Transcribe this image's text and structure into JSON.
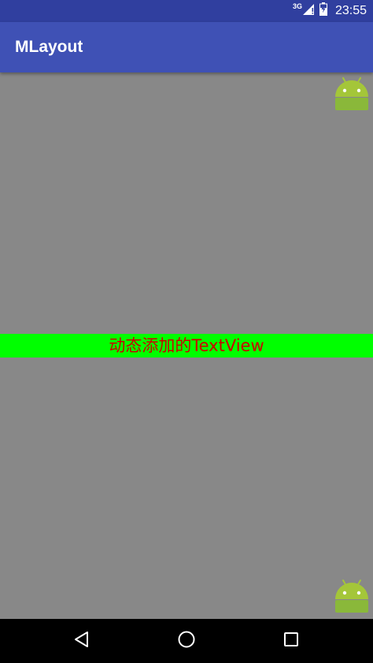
{
  "status_bar": {
    "network": "3G",
    "time": "23:55"
  },
  "app_bar": {
    "title": "MLayout"
  },
  "content": {
    "dynamic_text": "动态添加的TextView"
  },
  "icons": {
    "top_right": "android-robot-icon",
    "bottom_right": "android-robot-icon",
    "nav_back": "back-triangle-icon",
    "nav_home": "home-circle-icon",
    "nav_recents": "recents-square-icon"
  },
  "colors": {
    "status_bar": "#303F9F",
    "app_bar": "#3F51B5",
    "content_background": "#888888",
    "text_background": "#00FF00",
    "text_color": "#CC0000",
    "android_green": "#A4C639"
  }
}
